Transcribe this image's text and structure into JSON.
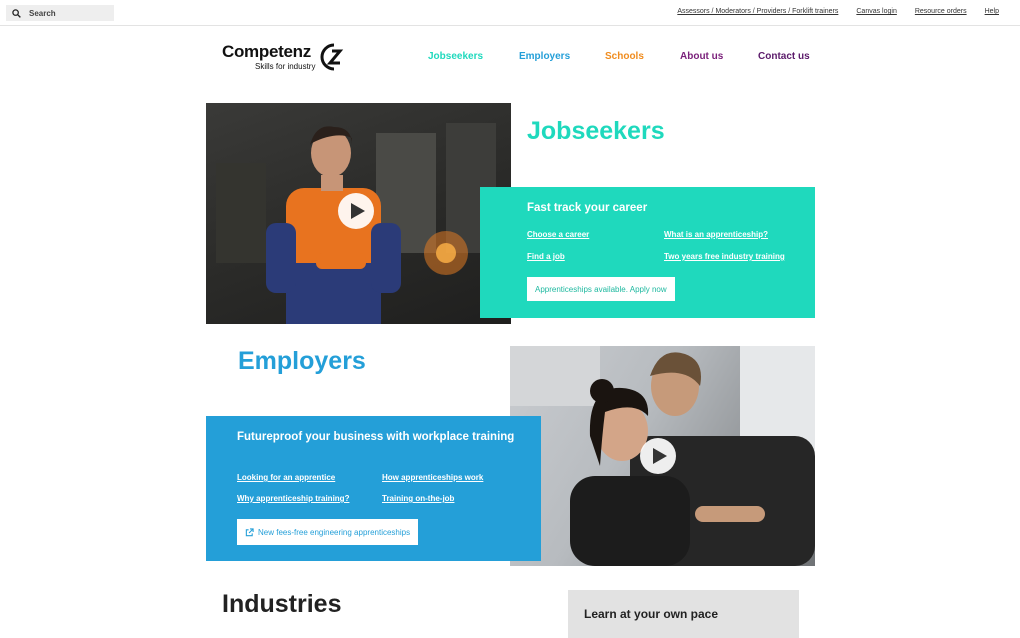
{
  "colors": {
    "jobseekers": "#1fd9bd",
    "employers": "#249fd8",
    "schools": "#f08c1e",
    "purple": "#7a1f7a",
    "contact": "#5b1a6a"
  },
  "topbar": {
    "search_label": "Search",
    "links": [
      "Assessors / Moderators / Providers / Forklift trainers",
      "Canvas login",
      "Resource orders",
      "Help"
    ]
  },
  "logo": {
    "name": "Competenz",
    "tagline": "Skills for industry"
  },
  "nav": {
    "jobseekers": "Jobseekers",
    "employers": "Employers",
    "schools": "Schools",
    "about": "About us",
    "contact": "Contact us"
  },
  "jobseekers": {
    "title": "Jobseekers",
    "panel_heading": "Fast track your career",
    "links": [
      "Choose a career",
      "What is an apprenticeship?",
      "Find a job",
      "Two years free industry training"
    ],
    "cta": "Apprenticeships available. Apply now"
  },
  "employers": {
    "title": "Employers",
    "panel_heading": "Futureproof your business with workplace training",
    "links": [
      "Looking for an apprentice",
      "How apprenticeships work",
      "Why apprenticeship training?",
      "Training on-the-job"
    ],
    "cta": "New fees-free engineering apprenticeships"
  },
  "industries": {
    "title": "Industries"
  },
  "learn": {
    "title": "Learn at your own pace"
  }
}
